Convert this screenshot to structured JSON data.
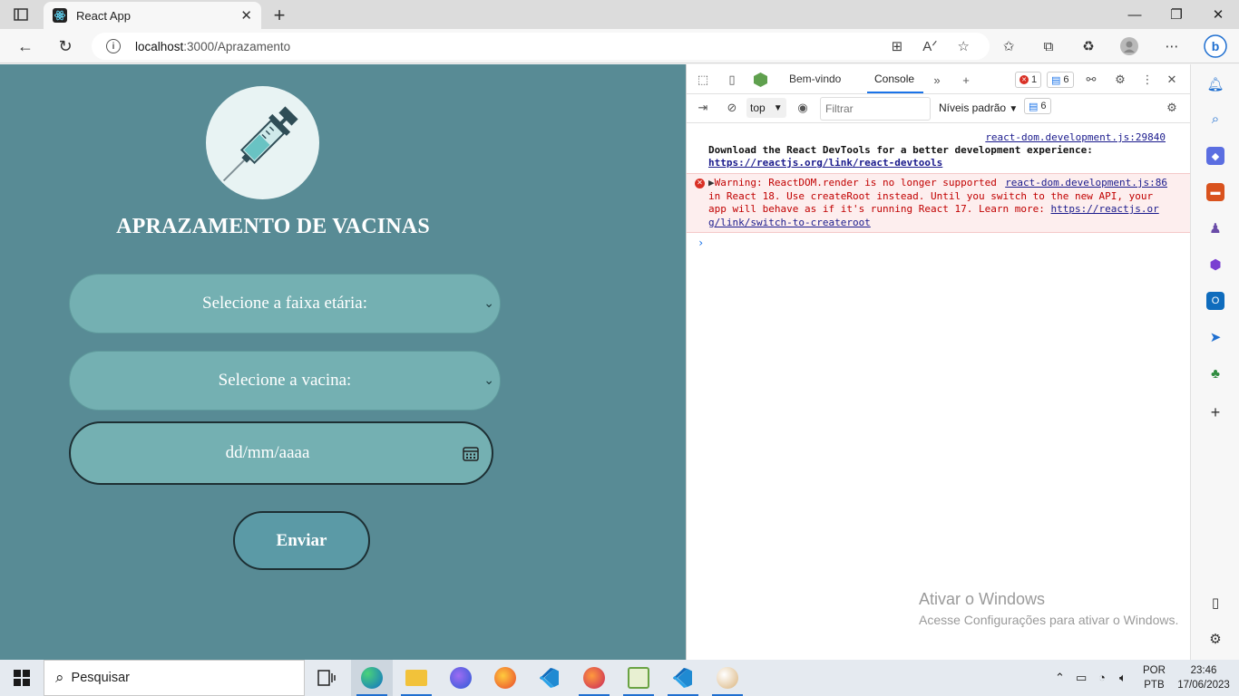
{
  "browser": {
    "tab_title": "React App",
    "url_host": "localhost",
    "url_path": ":3000/Aprazamento"
  },
  "page": {
    "title": "APRAZAMENTO DE VACINAS",
    "age_select": "Selecione a faixa etária:",
    "vaccine_select": "Selecione a vacina:",
    "date_placeholder": "dd/mm/aaaa",
    "submit_label": "Enviar"
  },
  "devtools": {
    "tabs": [
      "Bem-vindo",
      "Console"
    ],
    "error_count": "1",
    "message_count": "6",
    "context": "top",
    "filter_placeholder": "Filtrar",
    "levels": "Níveis padrão",
    "levels_count": "6",
    "messages": [
      {
        "source": "react-dom.development.js:29840",
        "text": "Download the React DevTools for a better development experience: ",
        "link": "https://reactjs.org/link/react-devtools"
      },
      {
        "source": "react-dom.development.js:86",
        "text": "Warning: ReactDOM.render is no longer supported in React 18. Use createRoot instead. Until you switch to the new API, your app will behave as if it's running React 17. Learn more: ",
        "link": "https://reactjs.org/link/switch-to-createroot"
      }
    ]
  },
  "watermark": {
    "line1": "Ativar o Windows",
    "line2": "Acesse Configurações para ativar o Windows."
  },
  "taskbar": {
    "search_placeholder": "Pesquisar",
    "lang1": "POR",
    "lang2": "PTB",
    "time": "23:46",
    "date": "17/06/2023"
  },
  "colors": {
    "page_bg": "#588b95",
    "field_bg": "#74b0b2",
    "button_bg": "#5b9aa6",
    "error_text": "#c10000"
  }
}
